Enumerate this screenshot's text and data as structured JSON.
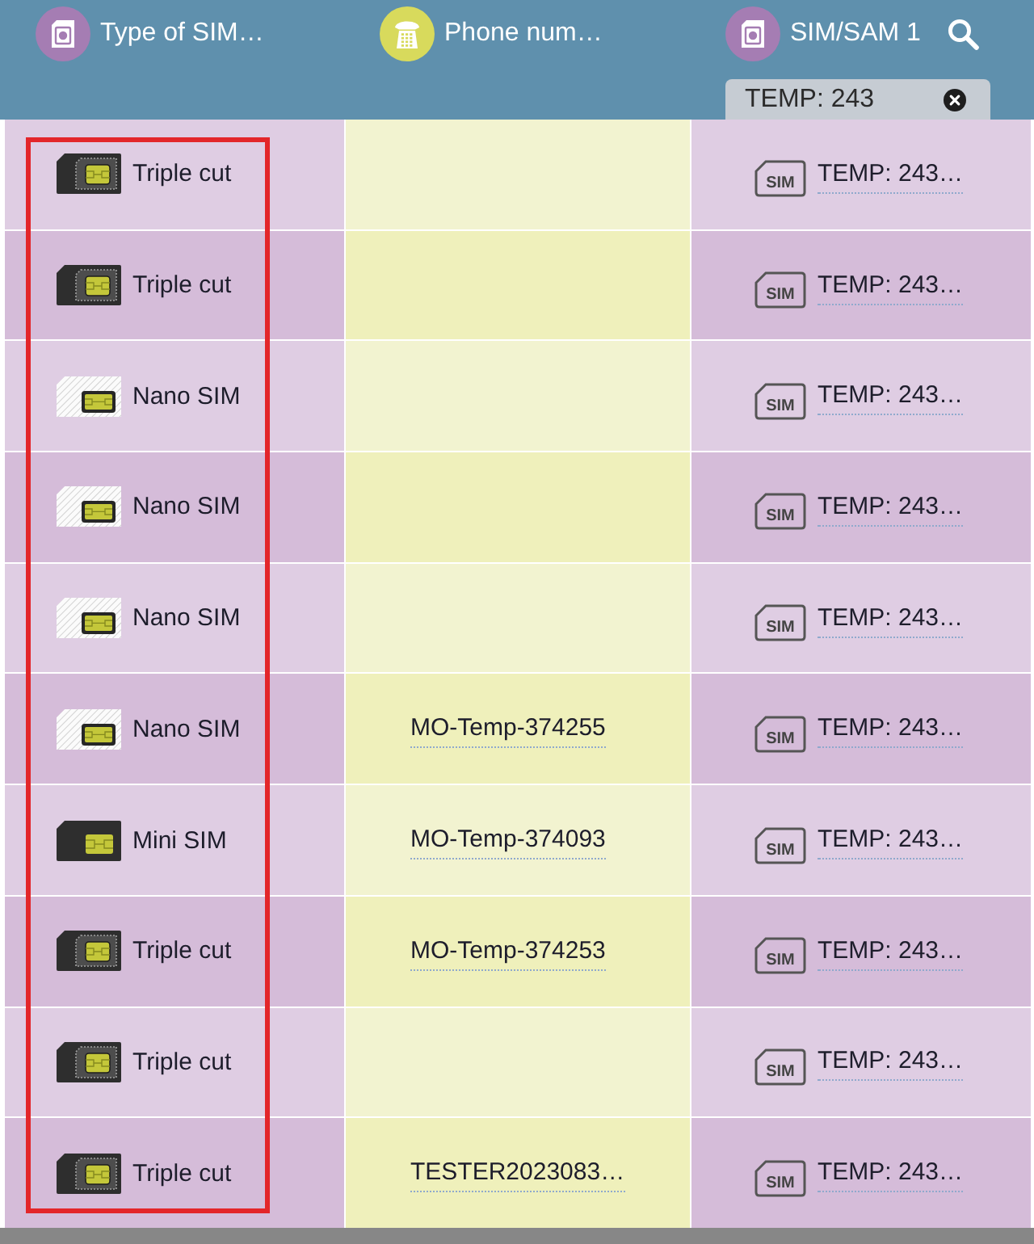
{
  "header": {
    "columns": [
      {
        "title": "Type of SIM…",
        "kind": "sim",
        "color": "#a57db3",
        "highlighted": true
      },
      {
        "title": "Phone num…",
        "kind": "phone",
        "color": "#d8da5c",
        "highlighted": false
      },
      {
        "title": "SIM/SAM 1",
        "kind": "sim",
        "color": "#a57db3",
        "highlighted": false,
        "filter": "TEMP: 243"
      }
    ]
  },
  "rows": [
    {
      "sim_type": {
        "kind": "triple-cut",
        "label": "Triple cut"
      },
      "sim_sam_1": {
        "badge": "SIM",
        "value": "TEMP: 243…"
      }
    },
    {
      "sim_type": {
        "kind": "triple-cut",
        "label": "Triple cut"
      },
      "sim_sam_1": {
        "badge": "SIM",
        "value": "TEMP: 243…"
      }
    },
    {
      "sim_type": {
        "kind": "nano",
        "label": "Nano SIM"
      },
      "sim_sam_1": {
        "badge": "SIM",
        "value": "TEMP: 243…"
      }
    },
    {
      "sim_type": {
        "kind": "nano",
        "label": "Nano SIM"
      },
      "sim_sam_1": {
        "badge": "SIM",
        "value": "TEMP: 243…"
      }
    },
    {
      "sim_type": {
        "kind": "nano",
        "label": "Nano SIM"
      },
      "sim_sam_1": {
        "badge": "SIM",
        "value": "TEMP: 243…"
      }
    },
    {
      "sim_type": {
        "kind": "nano",
        "label": "Nano SIM"
      },
      "phone_number": "MO-Temp-374255",
      "sim_sam_1": {
        "badge": "SIM",
        "value": "TEMP: 243…"
      }
    },
    {
      "sim_type": {
        "kind": "mini",
        "label": "Mini SIM"
      },
      "phone_number": "MO-Temp-374093",
      "sim_sam_1": {
        "badge": "SIM",
        "value": "TEMP: 243…"
      }
    },
    {
      "sim_type": {
        "kind": "triple-cut",
        "label": "Triple cut"
      },
      "phone_number": "MO-Temp-374253",
      "sim_sam_1": {
        "badge": "SIM",
        "value": "TEMP: 243…"
      }
    },
    {
      "sim_type": {
        "kind": "triple-cut",
        "label": "Triple cut"
      },
      "sim_sam_1": {
        "badge": "SIM",
        "value": "TEMP: 243…"
      }
    },
    {
      "sim_type": {
        "kind": "triple-cut",
        "label": "Triple cut"
      },
      "phone_number": "TESTER2023083…",
      "sim_sam_1": {
        "badge": "SIM",
        "value": "TEMP: 243…"
      }
    }
  ]
}
